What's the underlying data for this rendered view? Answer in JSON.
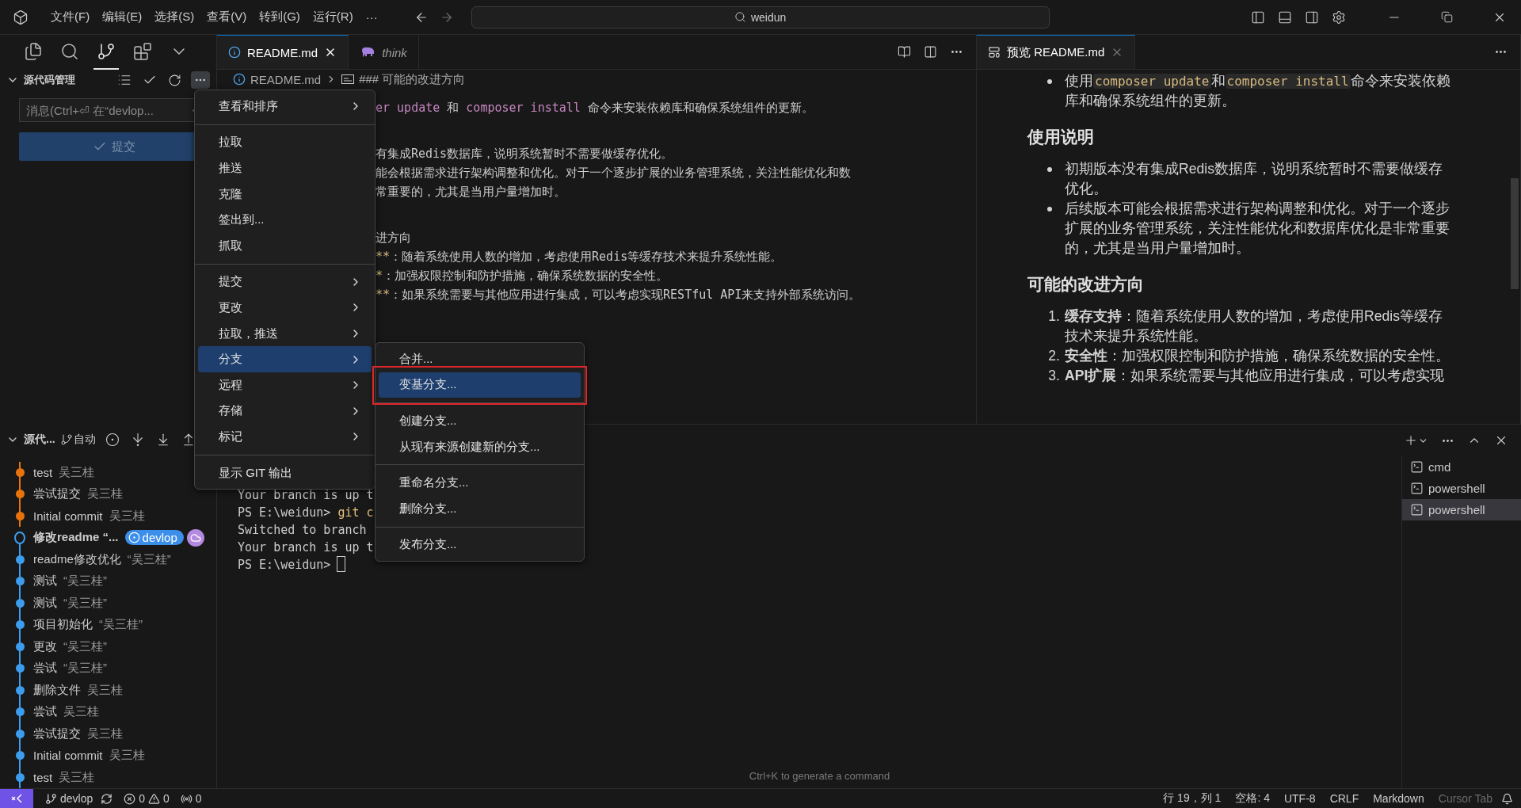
{
  "title_bar": {
    "menus": [
      "文件(F)",
      "编辑(E)",
      "选择(S)",
      "查看(V)",
      "转到(G)",
      "运行(R)"
    ],
    "overflow": "···",
    "search": "weidun"
  },
  "sidebar": {
    "views": [
      {
        "kind": "files",
        "selected": false
      },
      {
        "kind": "search",
        "selected": false
      },
      {
        "kind": "source-control",
        "selected": true
      },
      {
        "kind": "extensions",
        "selected": false
      },
      {
        "kind": "more",
        "selected": false
      }
    ],
    "scm": {
      "title": "源代码管理",
      "message_placeholder": "消息(Ctrl+⏎ 在“devlop...",
      "commit_label": "提交"
    },
    "graph": {
      "title": "源代...",
      "mode": "自动",
      "commits": [
        {
          "message": "test",
          "author": "吴三桂",
          "kind": "normal",
          "color": "#e8730c"
        },
        {
          "message": "尝试提交",
          "author": "吴三桂",
          "kind": "normal",
          "color": "#e8730c"
        },
        {
          "message": "Initial commit",
          "author": "吴三桂",
          "kind": "normal",
          "color": "#e8730c"
        },
        {
          "message": "修改readme “...",
          "kind": "head",
          "badge": "devlop",
          "color": "#3c9dee"
        },
        {
          "message": "readme修改优化",
          "author": "“吴三桂”",
          "kind": "normal",
          "color": "#3c9dee"
        },
        {
          "message": "测试",
          "author": "“吴三桂”",
          "kind": "normal",
          "color": "#3c9dee"
        },
        {
          "message": "测试",
          "author": "“吴三桂”",
          "kind": "normal",
          "color": "#3c9dee"
        },
        {
          "message": "项目初始化",
          "author": "“吴三桂”",
          "kind": "normal",
          "color": "#3c9dee"
        },
        {
          "message": "更改",
          "author": "“吴三桂”",
          "kind": "normal",
          "color": "#3c9dee"
        },
        {
          "message": "尝试",
          "author": "“吴三桂”",
          "kind": "normal",
          "color": "#3c9dee"
        },
        {
          "message": "删除文件",
          "author": "吴三桂",
          "kind": "normal",
          "color": "#3c9dee"
        },
        {
          "message": "尝试",
          "author": "吴三桂",
          "kind": "normal",
          "color": "#3c9dee"
        },
        {
          "message": "尝试提交",
          "author": "吴三桂",
          "kind": "normal",
          "color": "#3c9dee"
        },
        {
          "message": "Initial commit",
          "author": "吴三桂",
          "kind": "normal",
          "color": "#3c9dee"
        },
        {
          "message": "test",
          "author": "吴三桂",
          "kind": "normal",
          "color": "#3c9dee"
        }
      ]
    }
  },
  "editor": {
    "tabs": [
      {
        "label": "README.md",
        "kind": "info",
        "selected": true
      },
      {
        "label": "think",
        "kind": "elephant",
        "selected": false
      }
    ],
    "breadcrumb": [
      "README.md",
      "### 可能的改进方向"
    ],
    "blocks": [
      [
        [
          {
            "kind": "code",
            "text": "er update"
          },
          {
            "kind": "plain",
            "text": " 和 "
          },
          {
            "kind": "code",
            "text": "composer install"
          },
          {
            "kind": "plain",
            "text": " 命令来安装依赖库和确保系统组件的更新。"
          }
        ]
      ],
      [
        [
          {
            "kind": "plain",
            "text": "有集成Redis数据库，说明系统暂时不需要做缓存优化。"
          }
        ],
        [
          {
            "kind": "plain",
            "text": "能会根据需求进行架构调整和优化。对于一个逐步扩展的业务管理系统，关注性能优化和数"
          }
        ],
        [
          {
            "kind": "plain",
            "text": "常重要的，尤其是当用户量增加时。"
          }
        ]
      ],
      [
        [
          {
            "kind": "plain",
            "text": "进方向"
          }
        ],
        [
          {
            "kind": "syntax",
            "text": "**"
          },
          {
            "kind": "plain",
            "text": "：随着系统使用人数的增加，考虑使用Redis等缓存技术来提升系统性能。"
          }
        ],
        [
          {
            "kind": "syntax",
            "text": "*"
          },
          {
            "kind": "plain",
            "text": "：加强权限控制和防护措施，确保系统数据的安全性。"
          }
        ],
        [
          {
            "kind": "syntax",
            "text": "**"
          },
          {
            "kind": "plain",
            "text": "：如果系统需要与其他应用进行集成，可以考虑实现RESTful API来支持外部系统访问。"
          }
        ]
      ]
    ]
  },
  "preview": {
    "tab": "预览 README.md",
    "blocks": [
      {
        "kind": "bullets",
        "items": [
          [
            {
              "kind": "text",
              "text": "使用"
            },
            {
              "kind": "code",
              "text": "composer update"
            },
            {
              "kind": "text",
              "text": "和"
            },
            {
              "kind": "code",
              "text": "composer install"
            },
            {
              "kind": "text",
              "text": "命令来安装依赖库和确保系统组件的更新。"
            }
          ]
        ]
      },
      {
        "kind": "heading",
        "text": "使用说明"
      },
      {
        "kind": "bullets",
        "items": [
          [
            {
              "kind": "text",
              "text": "初期版本没有集成Redis数据库，说明系统暂时不需要做缓存优化。"
            }
          ],
          [
            {
              "kind": "text",
              "text": "后续版本可能会根据需求进行架构调整和优化。对于一个逐步扩展的业务管理系统，关注性能优化和数据库优化是非常重要的，尤其是当用户量增加时。"
            }
          ]
        ]
      },
      {
        "kind": "heading",
        "text": "可能的改进方向"
      },
      {
        "kind": "ordered",
        "items": [
          {
            "number": "1.",
            "text": "**缓存支持**：随着系统使用人数的增加，考虑使用Redis等缓存技术来提升系统性能。"
          },
          {
            "number": "2.",
            "text": "**安全性**：加强权限控制和防护措施，确保系统数据的安全性。"
          },
          {
            "number": "3.",
            "text": "**API扩展**：如果系统需要与其他应用进行集成，可以考虑实现"
          }
        ]
      }
    ]
  },
  "terminal": {
    "lines": [
      [
        {
          "kind": "plain",
          "text": "Your branch is up t"
        }
      ],
      [
        {
          "kind": "plain",
          "text": "PS E:\\weidun> "
        },
        {
          "kind": "command",
          "text": "git c"
        }
      ],
      [
        {
          "kind": "plain",
          "text": "Switched to branch"
        }
      ],
      [
        {
          "kind": "plain",
          "text": "Your branch is up t"
        }
      ],
      [
        {
          "kind": "plain",
          "text": "PS E:\\weidun>"
        }
      ]
    ],
    "hint": "Ctrl+K to generate a command",
    "sessions": [
      {
        "label": "cmd",
        "selected": false
      },
      {
        "label": "powershell",
        "selected": false
      },
      {
        "label": "powershell",
        "selected": true
      }
    ]
  },
  "menu": {
    "groups": [
      [
        {
          "label": "查看和排序",
          "has_submenu": true,
          "selected": false
        }
      ],
      [
        {
          "label": "拉取",
          "has_submenu": false,
          "selected": false
        },
        {
          "label": "推送",
          "has_submenu": false,
          "selected": false
        },
        {
          "label": "克隆",
          "has_submenu": false,
          "selected": false
        },
        {
          "label": "签出到...",
          "has_submenu": false,
          "selected": false
        },
        {
          "label": "抓取",
          "has_submenu": false,
          "selected": false
        }
      ],
      [
        {
          "label": "提交",
          "has_submenu": true,
          "selected": false
        },
        {
          "label": "更改",
          "has_submenu": true,
          "selected": false
        },
        {
          "label": "拉取，推送",
          "has_submenu": true,
          "selected": false
        },
        {
          "label": "分支",
          "has_submenu": true,
          "selected": true
        },
        {
          "label": "远程",
          "has_submenu": true,
          "selected": false
        },
        {
          "label": "存储",
          "has_submenu": true,
          "selected": false
        },
        {
          "label": "标记",
          "has_submenu": true,
          "selected": false
        }
      ],
      [
        {
          "label": "显示 GIT 输出",
          "has_submenu": false,
          "selected": false
        }
      ]
    ]
  },
  "branch_submenu": {
    "groups": [
      [
        {
          "label": "合并...",
          "selected": false
        },
        {
          "label": "变基分支...",
          "selected": true
        }
      ],
      [
        {
          "label": "创建分支...",
          "selected": false
        },
        {
          "label": "从现有来源创建新的分支...",
          "selected": false
        }
      ],
      [
        {
          "label": "重命名分支...",
          "selected": false
        },
        {
          "label": "删除分支...",
          "selected": false
        }
      ],
      [
        {
          "label": "发布分支...",
          "selected": false
        }
      ]
    ]
  },
  "status_bar": {
    "branch": "devlop",
    "errors": "0",
    "warnings": "0",
    "ports": "0",
    "right": [
      {
        "label": "行 19，列 1",
        "disabled": false
      },
      {
        "label": "空格: 4",
        "disabled": false
      },
      {
        "label": "UTF-8",
        "disabled": false
      },
      {
        "label": "CRLF",
        "disabled": false
      },
      {
        "label": "Markdown",
        "disabled": false
      },
      {
        "label": "Cursor Tab",
        "disabled": true
      }
    ]
  }
}
